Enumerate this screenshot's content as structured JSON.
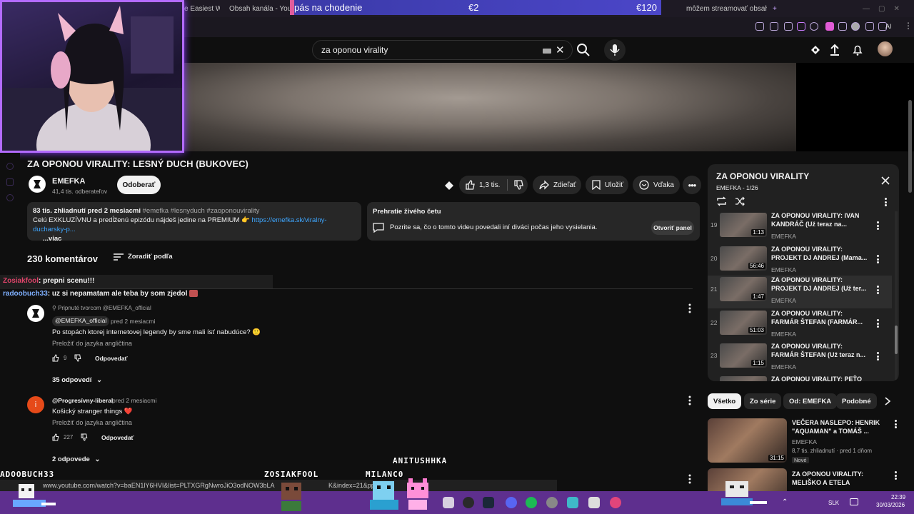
{
  "browser": {
    "tabs": [
      {
        "label": "e Easiest W"
      },
      {
        "label": "Obsah kanála - You"
      },
      {
        "label": "môžem streamovať obsah"
      }
    ],
    "stream_goal": {
      "label": "pás na chodenie",
      "current": "€2",
      "target": "€120"
    },
    "ai_label": "AI"
  },
  "youtube": {
    "search_query": "za oponou virality",
    "video_title": "ZA OPONOU VIRALITY: LESNÝ DUCH (BUKOVEC)",
    "channel": {
      "name": "EMEFKA",
      "subscribers": "41,4 tis. odberateľov",
      "subscribe_label": "Odoberať"
    },
    "actions": {
      "likes": "1,3 tis.",
      "share": "Zdieľať",
      "save": "Uložiť",
      "thanks": "Vďaka"
    },
    "description": {
      "meta": "83 tis. zhliadnutí  pred 2 mesiacmi",
      "tags": "#emefka #lesnyduch #zaoponouvirality",
      "text": "Celú EXKLUZÍVNU a predĺženú epizódu nájdeš jedine na PREMIUM 👉",
      "link": "https://emefka.sk/viralny-ducharsky-p...",
      "more": "...viac"
    },
    "live_chat": {
      "title": "Prehratie živého četu",
      "text": "Pozrite sa, čo o tomto videu povedali iní diváci počas jeho vysielania.",
      "button": "Otvoriť panel"
    },
    "comments": {
      "count": "230 komentárov",
      "sort": "Zoradiť podľa",
      "items": [
        {
          "pinned": "Pripnuté tvorcom @EMEFKA_official",
          "author": "@EMEFKA_official",
          "time": "pred 2 mesiacmi",
          "text": "Po stopách ktorej internetovej legendy by sme mali ísť nabudúce? 🙂",
          "translate": "Preložiť do jazyka angličtina",
          "likes": "9",
          "reply": "Odpovedať",
          "replies": "35 odpovedí"
        },
        {
          "author": "@Progresívny-liberal",
          "time": "pred 2 mesiacmi",
          "text": "Košický stranger things ❤️",
          "translate": "Preložiť do jazyka angličtina",
          "likes": "227",
          "reply": "Odpovedať",
          "replies": "2 odpovede",
          "avatar_letter": "i"
        }
      ]
    },
    "playlist": {
      "title": "ZA OPONOU VIRALITY",
      "subtitle": "EMEFKA - 1/26",
      "items": [
        {
          "num": "19",
          "title": "ZA OPONOU VIRALITY: IVAN KANDRÁČ (Už teraz na...",
          "channel": "EMEFKA",
          "duration": "1:13"
        },
        {
          "num": "20",
          "title": "ZA OPONOU VIRALITY: PROJEKT DJ ANDREJ (Mama...",
          "channel": "EMEFKA",
          "duration": "56:46"
        },
        {
          "num": "21",
          "title": "ZA OPONOU VIRALITY: PROJEKT DJ ANDREJ (Už ter...",
          "channel": "EMEFKA",
          "duration": "1:47"
        },
        {
          "num": "22",
          "title": "ZA OPONOU VIRALITY: FARMÁR ŠTEFAN (FARMÁR...",
          "channel": "EMEFKA",
          "duration": "51:03"
        },
        {
          "num": "23",
          "title": "ZA OPONOU VIRALITY: FARMÁR ŠTEFAN (Už teraz n...",
          "channel": "EMEFKA",
          "duration": "1:15"
        },
        {
          "num": "",
          "title": "ZA OPONOU VIRALITY: PEŤO",
          "channel": "",
          "duration": ""
        }
      ]
    },
    "chips": [
      "Všetko",
      "Zo série",
      "Od: EMEFKA",
      "Podobné"
    ],
    "recommendations": [
      {
        "title": "VEČERA NASLEPO: HENRIK \"AQUAMAN\" a TOMÁŠ ...",
        "channel": "EMEFKA",
        "meta": "8,7 tis. zhliadnutí · pred 1 dňom",
        "badge": "Nové",
        "duration": "31:15"
      },
      {
        "title": "ZA OPONOU VIRALITY: MELIŠKO A ETELA",
        "channel": "",
        "meta": "",
        "badge": "",
        "duration": ""
      }
    ]
  },
  "overlay_chat": [
    {
      "user": "Zosiakfool",
      "message": ": prepni scenu!!!",
      "color": "#e0446a"
    },
    {
      "user": "radoobuch33",
      "message": ": uz si nepamatam ale teba by som zjedol",
      "color": "#7fb0ff"
    }
  ],
  "pixel_names": [
    "ADOOBUCH33",
    "ZOSIAKFOOL",
    "MILANC0",
    "ANITUSHHKA"
  ],
  "status_url": "www.youtube.com/watch?v=baEN1lY6HVI&list=PLTXGRgNwroJiO3odNOW3bLA",
  "status_url_tail": "K&index=21&pp=i",
  "taskbar": {
    "lang": "SLK",
    "time": "22:39",
    "date": "30/03/2026"
  }
}
